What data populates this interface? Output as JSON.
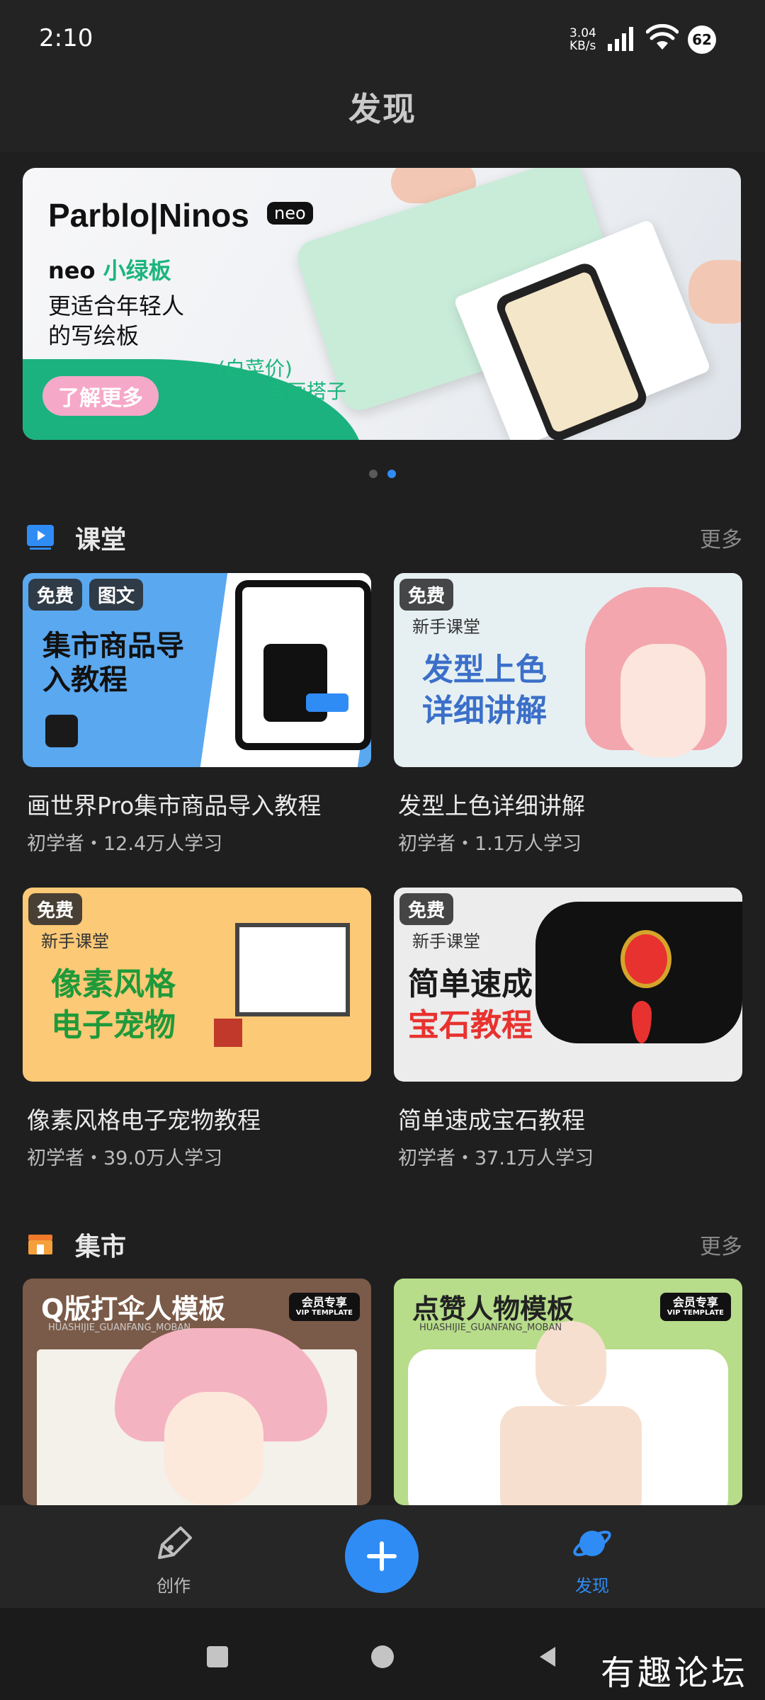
{
  "status_bar": {
    "time": "2:10",
    "net_speed_value": "3.04",
    "net_speed_unit": "KB/s",
    "battery": "62"
  },
  "page": {
    "title": "发现"
  },
  "banner": {
    "brand": "Parblo|Ninos",
    "brand_badge": "neo",
    "product_prefix": "neo",
    "product_name": "小绿板",
    "line2": "更适合年轻人",
    "line3": "的写绘板",
    "cta": "了解更多",
    "price_note": "(白菜价)",
    "tagline": "写画搭子",
    "page_count": 2,
    "active_page": 2
  },
  "sections": {
    "classroom": {
      "title": "课堂",
      "more": "更多",
      "courses": [
        {
          "badges": [
            "免费",
            "图文"
          ],
          "thumb_line1": "集市商品导",
          "thumb_line2": "入教程",
          "title": "画世界Pro集市商品导入教程",
          "meta": "初学者・12.4万人学习"
        },
        {
          "badges": [
            "免费"
          ],
          "thumb_kicker": "新手课堂",
          "thumb_line1": "发型上色",
          "thumb_line2": "详细讲解",
          "title": "发型上色详细讲解",
          "meta": "初学者・1.1万人学习"
        },
        {
          "badges": [
            "免费"
          ],
          "thumb_kicker": "新手课堂",
          "thumb_line1": "像素风格",
          "thumb_line2": "电子宠物",
          "title": "像素风格电子宠物教程",
          "meta": "初学者・39.0万人学习"
        },
        {
          "badges": [
            "免费"
          ],
          "thumb_kicker": "新手课堂",
          "thumb_line1": "简单速成",
          "thumb_line2": "宝石教程",
          "title": "简单速成宝石教程",
          "meta": "初学者・37.1万人学习"
        }
      ]
    },
    "market": {
      "title": "集市",
      "more": "更多",
      "items": [
        {
          "title": "Q版打伞人模板",
          "sub": "HUASHIJIE_GUANFANG_MOBAN",
          "vip_line1": "会员专享",
          "vip_line2": "VIP TEMPLATE",
          "bg": "#7a5a48"
        },
        {
          "title": "点赞人物模板",
          "sub": "HUASHIJIE_GUANFANG_MOBAN",
          "vip_line1": "会员专享",
          "vip_line2": "VIP TEMPLATE",
          "bg": "#b7dc8a"
        }
      ]
    }
  },
  "bottom_nav": {
    "create_label": "创作",
    "discover_label": "发现",
    "active": "discover"
  },
  "watermark": "有趣论坛",
  "colors": {
    "accent": "#2f8cf5",
    "banner_green": "#1bb27f",
    "market_orange": "#f07a2a"
  }
}
